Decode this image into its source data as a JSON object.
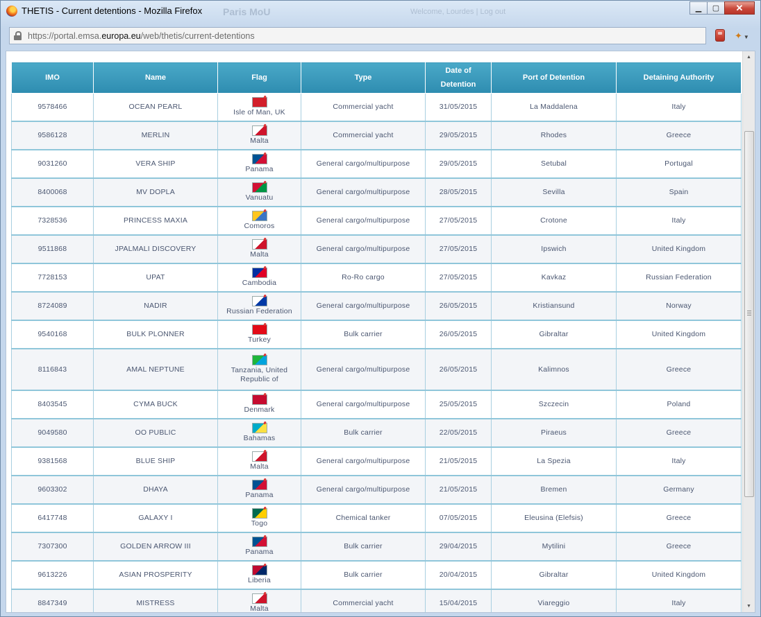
{
  "window": {
    "title": "THETIS - Current detentions - Mozilla Firefox",
    "background_text_1": "Paris MoU",
    "background_text_2": "Welcome, Lourdes | Log out",
    "controls": {
      "minimize": "▁",
      "maximize": "▢",
      "close": "✕"
    }
  },
  "urlbar": {
    "prefix": "https://portal.emsa.",
    "domain": "europa.eu",
    "suffix": "/web/thetis/current-detentions"
  },
  "table": {
    "headers": {
      "imo": "IMO",
      "name": "Name",
      "flag": "Flag",
      "type": "Type",
      "date_line1": "Date of",
      "date_line2": "Detention",
      "port": "Port of Detention",
      "authority": "Detaining Authority"
    },
    "rows": [
      {
        "imo": "9578466",
        "name": "OCEAN PEARL",
        "flag": "Isle of Man, UK",
        "flag_colors": [
          "#d21f2a",
          "#d21f2a"
        ],
        "type": "Commercial yacht",
        "date": "31/05/2015",
        "port": "La Maddalena",
        "authority": "Italy"
      },
      {
        "imo": "9586128",
        "name": "MERLIN",
        "flag": "Malta",
        "flag_colors": [
          "#ffffff",
          "#cf142b"
        ],
        "type": "Commercial yacht",
        "date": "29/05/2015",
        "port": "Rhodes",
        "authority": "Greece"
      },
      {
        "imo": "9031260",
        "name": "VERA SHIP",
        "flag": "Panama",
        "flag_colors": [
          "#005293",
          "#d21034"
        ],
        "type": "General cargo/multipurpose",
        "date": "29/05/2015",
        "port": "Setubal",
        "authority": "Portugal"
      },
      {
        "imo": "8400068",
        "name": "MV DOPLA",
        "flag": "Vanuatu",
        "flag_colors": [
          "#d21034",
          "#009543"
        ],
        "type": "General cargo/multipurpose",
        "date": "28/05/2015",
        "port": "Sevilla",
        "authority": "Spain"
      },
      {
        "imo": "7328536",
        "name": "PRINCESS MAXIA",
        "flag": "Comoros",
        "flag_colors": [
          "#ffc61e",
          "#3a75c4"
        ],
        "type": "General cargo/multipurpose",
        "date": "27/05/2015",
        "port": "Crotone",
        "authority": "Italy"
      },
      {
        "imo": "9511868",
        "name": "JPALMALI DISCOVERY",
        "flag": "Malta",
        "flag_colors": [
          "#ffffff",
          "#cf142b"
        ],
        "type": "General cargo/multipurpose",
        "date": "27/05/2015",
        "port": "Ipswich",
        "authority": "United Kingdom"
      },
      {
        "imo": "7728153",
        "name": "UPAT",
        "flag": "Cambodia",
        "flag_colors": [
          "#032ea1",
          "#e00025"
        ],
        "type": "Ro-Ro cargo",
        "date": "27/05/2015",
        "port": "Kavkaz",
        "authority": "Russian Federation"
      },
      {
        "imo": "8724089",
        "name": "NADIR",
        "flag": "Russian Federation",
        "flag_colors": [
          "#ffffff",
          "#0039a6"
        ],
        "type": "General cargo/multipurpose",
        "date": "26/05/2015",
        "port": "Kristiansund",
        "authority": "Norway"
      },
      {
        "imo": "9540168",
        "name": "BULK PLONNER",
        "flag": "Turkey",
        "flag_colors": [
          "#e30a17",
          "#e30a17"
        ],
        "type": "Bulk carrier",
        "date": "26/05/2015",
        "port": "Gibraltar",
        "authority": "United Kingdom"
      },
      {
        "imo": "8116843",
        "name": "AMAL NEPTUNE",
        "flag": "Tanzania, United Republic of",
        "flag_colors": [
          "#1eb53a",
          "#00a3dd"
        ],
        "type": "General cargo/multipurpose",
        "date": "26/05/2015",
        "port": "Kalimnos",
        "authority": "Greece",
        "tall": true
      },
      {
        "imo": "8403545",
        "name": "CYMA BUCK",
        "flag": "Denmark",
        "flag_colors": [
          "#c60c30",
          "#c60c30"
        ],
        "type": "General cargo/multipurpose",
        "date": "25/05/2015",
        "port": "Szczecin",
        "authority": "Poland"
      },
      {
        "imo": "9049580",
        "name": "OO PUBLIC",
        "flag": "Bahamas",
        "flag_colors": [
          "#00abc9",
          "#fae042"
        ],
        "type": "Bulk carrier",
        "date": "22/05/2015",
        "port": "Piraeus",
        "authority": "Greece"
      },
      {
        "imo": "9381568",
        "name": "BLUE SHIP",
        "flag": "Malta",
        "flag_colors": [
          "#ffffff",
          "#cf142b"
        ],
        "type": "General cargo/multipurpose",
        "date": "21/05/2015",
        "port": "La Spezia",
        "authority": "Italy"
      },
      {
        "imo": "9603302",
        "name": "DHAYA",
        "flag": "Panama",
        "flag_colors": [
          "#005293",
          "#d21034"
        ],
        "type": "General cargo/multipurpose",
        "date": "21/05/2015",
        "port": "Bremen",
        "authority": "Germany"
      },
      {
        "imo": "6417748",
        "name": "GALAXY I",
        "flag": "Togo",
        "flag_colors": [
          "#006a4e",
          "#ffce00"
        ],
        "type": "Chemical tanker",
        "date": "07/05/2015",
        "port": "Eleusina (Elefsis)",
        "authority": "Greece"
      },
      {
        "imo": "7307300",
        "name": "GOLDEN ARROW III",
        "flag": "Panama",
        "flag_colors": [
          "#005293",
          "#d21034"
        ],
        "type": "Bulk carrier",
        "date": "29/04/2015",
        "port": "Mytilini",
        "authority": "Greece"
      },
      {
        "imo": "9613226",
        "name": "ASIAN PROSPERITY",
        "flag": "Liberia",
        "flag_colors": [
          "#bf0a30",
          "#002868"
        ],
        "type": "Bulk carrier",
        "date": "20/04/2015",
        "port": "Gibraltar",
        "authority": "United Kingdom"
      },
      {
        "imo": "8847349",
        "name": "MISTRESS",
        "flag": "Malta",
        "flag_colors": [
          "#ffffff",
          "#cf142b"
        ],
        "type": "Commercial yacht",
        "date": "15/04/2015",
        "port": "Viareggio",
        "authority": "Italy"
      }
    ]
  }
}
